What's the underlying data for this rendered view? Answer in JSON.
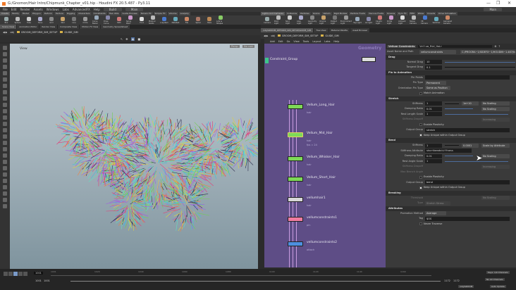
{
  "window": {
    "title": "G:/Gnomon/Hair Intro/Chipmunk_Chapter_v01.hip - Houdini FX 20.5.487 - Py3.11",
    "min": "—",
    "max": "❐",
    "close": "✕"
  },
  "menu": [
    "File",
    "Edit",
    "Render",
    "Assets",
    "Windows",
    "Labs",
    "AdvancedFX",
    "Help"
  ],
  "desktop": "Build",
  "desktop2": "Main",
  "desktop_right": "Main",
  "shelf_tabs_left": [
    "Create",
    "Modify",
    "Model",
    "Polygon",
    "Deform",
    "Texture",
    "Rigging",
    "Characters",
    "Constraints",
    "Hair Utils",
    "Guide Process",
    "Terrain FX",
    "Simple FX",
    "Volume",
    "Lowpoly"
  ],
  "shelf_tools_left": [
    "Box",
    "Sphere",
    "Tube",
    "Torus",
    "Grid",
    "Null",
    "Line",
    "Circle",
    "Curve Bezier",
    "Draw Curve",
    "Path",
    "Spray Paint",
    "Font",
    "Platonic Solids",
    "L-System",
    "Metaball",
    "File",
    "Spiral",
    "Helix",
    "Lots & Shapes"
  ],
  "shelf_tabs_right": [
    "Lights and Cameras",
    "Collisions",
    "Particles",
    "Grains",
    "Vellum",
    "Rigid Bodies",
    "Particle Fluids",
    "Viscous Fluids",
    "Oceans",
    "Pyro FX",
    "FEM",
    "Wires",
    "Crowds",
    "Drive Simulation"
  ],
  "shelf_tools_right": [
    "Camera",
    "Point Light",
    "Spot Light",
    "Area Light",
    "Geometry Light",
    "Volume Light",
    "Distant Light",
    "Environment Light",
    "Sky Light",
    "GI Light",
    "Caustic Light",
    "Portal Light",
    "Ambient Light",
    "Stereo Camera",
    "VR Camera",
    "Switcher",
    "Gamepad Camera"
  ],
  "pane_tabs_left": [
    "Scene View",
    "Animation Editor",
    "Render View",
    "Composite View",
    "Motion FX View",
    "Geometry Spreadsheet"
  ],
  "pane_tabs_right": [
    "/obj/GROOM_DEFORM_SIM_SETUP/GUIDE_SIM",
    "Tree View",
    "Material Palette",
    "Asset Browser"
  ],
  "path": {
    "root": "obj",
    "node1": "GROOM_DEFORM_SIM_SETUP",
    "node2": "GUIDE_SIM"
  },
  "viewport": {
    "label": "View",
    "persp": "Persp",
    "cam": "No cam"
  },
  "netmenu": [
    "Add",
    "Edit",
    "Go",
    "View",
    "Tools",
    "Layout",
    "Labs",
    "Help"
  ],
  "network": {
    "context_label": "Geometry",
    "top_node": "Constraint_Group",
    "nodes": [
      {
        "name": "Vellum_Long_Hair",
        "sub": "hair",
        "color": "#7ed957"
      },
      {
        "name": "Vellum_Mid_Hair",
        "sub": "hair",
        "extra": "fps = 24",
        "color": "#7ed957"
      },
      {
        "name": "Vellum_Whisker_Hair",
        "sub": "hair",
        "color": "#7ed957"
      },
      {
        "name": "Vellum_Short_Hair",
        "sub": "hair",
        "color": "#7ed957"
      },
      {
        "name": "vellumhair1",
        "sub": "hair",
        "color": "#d8d8d8"
      },
      {
        "name": "vellumconstraints1",
        "sub": "pin",
        "color": "#f07ca0"
      },
      {
        "name": "vellumconstraints2",
        "sub": "attach",
        "color": "#4d8fe0"
      }
    ]
  },
  "params": {
    "type": "Vellum Constraints",
    "name": "Vellum_Mid_Hair",
    "asset_label": "Asset Name and Path",
    "asset_name": "vellumconstraints",
    "asset_path": "C:/PROGRA~1/SIDEFX~1/HOUDIN~1.487/houdini/o",
    "drag": {
      "title": "Drag",
      "normal_label": "Normal Drag",
      "normal": "10",
      "tangent_label": "Tangent Drag",
      "tangent": "0.1"
    },
    "pin": {
      "title": "Pin to Animation",
      "points_label": "Pin Points",
      "type_label": "Pin Type",
      "type": "Permanent",
      "orient_label": "Orientation Pin Type",
      "orient": "Same as Position",
      "match": "Match Animation"
    },
    "stretch": {
      "title": "Stretch",
      "stiff_label": "Stiffness",
      "stiff": "1",
      "stiff_exp": "1e+10",
      "scaling": "No Scaling",
      "damp_label": "Damping Ratio",
      "damp": "0.01",
      "rest_label": "Rest Length Scale",
      "rest": "1",
      "dropoff_label": "Stiffness Dropoff",
      "dropoff_mode": "Increasing",
      "plastic": "Enable Plasticity",
      "outgrp_label": "Output Group",
      "outgrp": "stretch",
      "keep": "Keep Unique within Output Group"
    },
    "bend": {
      "title": "Bend",
      "stiff_label": "Stiffness",
      "stiff": "1",
      "stiff_exp": "0.0001",
      "scaling": "Scale by Attribute",
      "attr_label": "Stiffness Attribute",
      "attr": "shortbendstiffness",
      "damp_label": "Damping Ratio",
      "damp": "0.01",
      "rest_label": "Rest Angle Scale",
      "rest": "1",
      "dropoff_label": "Stiffness Dropoff",
      "dropoff_mode": "Increasing",
      "maxbranch_label": "Max Branch Angle",
      "plastic": "Enable Plasticity",
      "outgrp_label": "Output Group",
      "outgrp": "bend",
      "keep": "Keep Unique within Output Group"
    },
    "breaking": {
      "title": "Breaking",
      "thresh_label": "Threshold",
      "type_label": "Type",
      "type": "Stretch Stress"
    },
    "attributes": {
      "title": "Attributes",
      "promo_label": "Promotion Method",
      "promo": "Average",
      "tag_label": "Tag",
      "tag": "$OS",
      "never": "Never Traverse"
    }
  },
  "timeline": {
    "frame": "1001",
    "start": "1001",
    "start2": "1001",
    "end": "1172",
    "end2": "1172",
    "ticks": [
      "1001",
      "1020",
      "1040",
      "1060",
      "1080",
      "1100",
      "1120",
      "1140",
      "1160"
    ],
    "keys": "Keys: 1/0 Channels",
    "all": "No All Channels",
    "update": "Auto Update",
    "sel": "/obj/GROOM"
  },
  "colors": {
    "network_bg": "#5e4d86"
  }
}
